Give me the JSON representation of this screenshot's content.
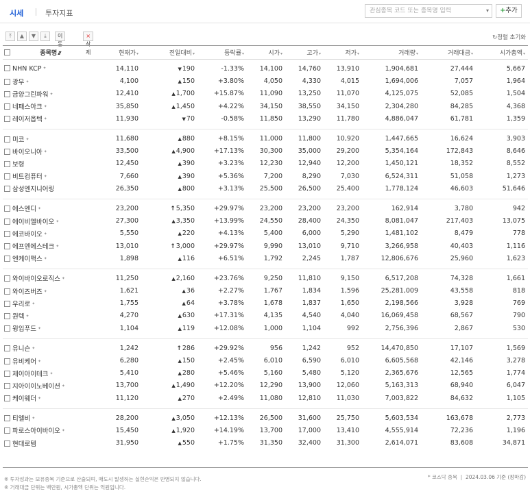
{
  "tabs": [
    {
      "label": "시세",
      "active": true
    },
    {
      "label": "투자지표",
      "active": false
    }
  ],
  "search": {
    "placeholder": "관심종목 코드 또는 종목명 입력",
    "add_label": "추가"
  },
  "tools": {
    "move_label": "이동",
    "delete_label": "삭제",
    "sort_reset_label": "정렬 초기화"
  },
  "columns": [
    "종목명",
    "현재가",
    "전일대비",
    "등락률",
    "시가",
    "고가",
    "저가",
    "거래량",
    "거래대금",
    "시가총액"
  ],
  "groups": [
    [
      {
        "name": "NHN KCP",
        "star": true,
        "price": "14,110",
        "dir": "down",
        "change": "190",
        "rate": "-1.33%",
        "open": "14,100",
        "high": "14,760",
        "low": "13,910",
        "volume": "1,904,681",
        "value": "27,444",
        "cap": "5,667"
      },
      {
        "name": "광무",
        "star": true,
        "price": "4,100",
        "dir": "up",
        "change": "150",
        "rate": "+3.80%",
        "open": "4,050",
        "high": "4,330",
        "low": "4,015",
        "volume": "1,694,006",
        "value": "7,057",
        "cap": "1,964"
      },
      {
        "name": "금양그린파워",
        "star": true,
        "price": "12,410",
        "dir": "up",
        "change": "1,700",
        "rate": "+15.87%",
        "open": "11,090",
        "high": "13,250",
        "low": "11,070",
        "volume": "4,125,075",
        "value": "52,085",
        "cap": "1,504"
      },
      {
        "name": "네패스아크",
        "star": true,
        "price": "35,850",
        "dir": "up",
        "change": "1,450",
        "rate": "+4.22%",
        "open": "34,150",
        "high": "38,550",
        "low": "34,150",
        "volume": "2,304,280",
        "value": "84,285",
        "cap": "4,368"
      },
      {
        "name": "레이저옵텍",
        "star": true,
        "price": "11,930",
        "dir": "down",
        "change": "70",
        "rate": "-0.58%",
        "open": "11,850",
        "high": "13,290",
        "low": "11,780",
        "volume": "4,886,047",
        "value": "61,781",
        "cap": "1,359"
      }
    ],
    [
      {
        "name": "미코",
        "star": true,
        "price": "11,680",
        "dir": "up",
        "change": "880",
        "rate": "+8.15%",
        "open": "11,000",
        "high": "11,800",
        "low": "10,920",
        "volume": "1,447,665",
        "value": "16,624",
        "cap": "3,903"
      },
      {
        "name": "바이오니아",
        "star": true,
        "price": "33,500",
        "dir": "up",
        "change": "4,900",
        "rate": "+17.13%",
        "open": "30,300",
        "high": "35,000",
        "low": "29,200",
        "volume": "5,354,164",
        "value": "172,843",
        "cap": "8,646"
      },
      {
        "name": "보령",
        "star": false,
        "price": "12,450",
        "dir": "up",
        "change": "390",
        "rate": "+3.23%",
        "open": "12,230",
        "high": "12,940",
        "low": "12,200",
        "volume": "1,450,121",
        "value": "18,352",
        "cap": "8,552"
      },
      {
        "name": "비트컴퓨터",
        "star": true,
        "price": "7,660",
        "dir": "up",
        "change": "390",
        "rate": "+5.36%",
        "open": "7,200",
        "high": "8,290",
        "low": "7,030",
        "volume": "6,524,311",
        "value": "51,058",
        "cap": "1,273"
      },
      {
        "name": "삼성엔지니어링",
        "star": false,
        "price": "26,350",
        "dir": "up",
        "change": "800",
        "rate": "+3.13%",
        "open": "25,500",
        "high": "26,500",
        "low": "25,400",
        "volume": "1,778,124",
        "value": "46,603",
        "cap": "51,646"
      }
    ],
    [
      {
        "name": "에스엔디",
        "star": true,
        "price": "23,200",
        "dir": "limit",
        "change": "5,350",
        "rate": "+29.97%",
        "open": "23,200",
        "high": "23,200",
        "low": "23,200",
        "volume": "162,914",
        "value": "3,780",
        "cap": "942"
      },
      {
        "name": "에이비엘바이오",
        "star": true,
        "price": "27,300",
        "dir": "up",
        "change": "3,350",
        "rate": "+13.99%",
        "open": "24,550",
        "high": "28,400",
        "low": "24,350",
        "volume": "8,081,047",
        "value": "217,403",
        "cap": "13,075"
      },
      {
        "name": "에코바이오",
        "star": true,
        "price": "5,550",
        "dir": "up",
        "change": "220",
        "rate": "+4.13%",
        "open": "5,400",
        "high": "6,000",
        "low": "5,290",
        "volume": "1,481,102",
        "value": "8,479",
        "cap": "778"
      },
      {
        "name": "에프엔에스테크",
        "star": true,
        "price": "13,010",
        "dir": "limit",
        "change": "3,000",
        "rate": "+29.97%",
        "open": "9,990",
        "high": "13,010",
        "low": "9,710",
        "volume": "3,266,958",
        "value": "40,403",
        "cap": "1,116"
      },
      {
        "name": "엔케이맥스",
        "star": true,
        "price": "1,898",
        "dir": "up",
        "change": "116",
        "rate": "+6.51%",
        "open": "1,792",
        "high": "2,245",
        "low": "1,787",
        "volume": "12,806,676",
        "value": "25,960",
        "cap": "1,623"
      }
    ],
    [
      {
        "name": "와이바이오로직스",
        "star": true,
        "price": "11,250",
        "dir": "up",
        "change": "2,160",
        "rate": "+23.76%",
        "open": "9,250",
        "high": "11,810",
        "low": "9,150",
        "volume": "6,517,208",
        "value": "74,328",
        "cap": "1,661"
      },
      {
        "name": "와이즈버즈",
        "star": true,
        "price": "1,621",
        "dir": "up",
        "change": "36",
        "rate": "+2.27%",
        "open": "1,767",
        "high": "1,834",
        "low": "1,596",
        "volume": "25,281,009",
        "value": "43,558",
        "cap": "818"
      },
      {
        "name": "우리로",
        "star": true,
        "price": "1,755",
        "dir": "up",
        "change": "64",
        "rate": "+3.78%",
        "open": "1,678",
        "high": "1,837",
        "low": "1,650",
        "volume": "2,198,566",
        "value": "3,928",
        "cap": "769"
      },
      {
        "name": "원텍",
        "star": true,
        "price": "4,270",
        "dir": "up",
        "change": "630",
        "rate": "+17.31%",
        "open": "4,135",
        "high": "4,540",
        "low": "4,040",
        "volume": "16,069,458",
        "value": "68,567",
        "cap": "790"
      },
      {
        "name": "윙입푸드",
        "star": true,
        "price": "1,104",
        "dir": "up",
        "change": "119",
        "rate": "+12.08%",
        "open": "1,000",
        "high": "1,104",
        "low": "992",
        "volume": "2,756,396",
        "value": "2,867",
        "cap": "530"
      }
    ],
    [
      {
        "name": "유니슨",
        "star": true,
        "price": "1,242",
        "dir": "limit",
        "change": "286",
        "rate": "+29.92%",
        "open": "956",
        "high": "1,242",
        "low": "952",
        "volume": "14,470,850",
        "value": "17,107",
        "cap": "1,569"
      },
      {
        "name": "유비케어",
        "star": true,
        "price": "6,280",
        "dir": "up",
        "change": "150",
        "rate": "+2.45%",
        "open": "6,010",
        "high": "6,590",
        "low": "6,010",
        "volume": "6,605,568",
        "value": "42,146",
        "cap": "3,278"
      },
      {
        "name": "제이아이테크",
        "star": true,
        "price": "5,410",
        "dir": "up",
        "change": "280",
        "rate": "+5.46%",
        "open": "5,160",
        "high": "5,480",
        "low": "5,120",
        "volume": "2,365,676",
        "value": "12,565",
        "cap": "1,774"
      },
      {
        "name": "지아이이노베이션",
        "star": true,
        "price": "13,700",
        "dir": "up",
        "change": "1,490",
        "rate": "+12.20%",
        "open": "12,290",
        "high": "13,900",
        "low": "12,060",
        "volume": "5,163,313",
        "value": "68,940",
        "cap": "6,047"
      },
      {
        "name": "케이웨더",
        "star": true,
        "price": "11,120",
        "dir": "up",
        "change": "270",
        "rate": "+2.49%",
        "open": "11,080",
        "high": "12,810",
        "low": "11,030",
        "volume": "7,003,822",
        "value": "84,632",
        "cap": "1,105"
      }
    ],
    [
      {
        "name": "티엘비",
        "star": true,
        "price": "28,200",
        "dir": "up",
        "change": "3,050",
        "rate": "+12.13%",
        "open": "26,500",
        "high": "31,600",
        "low": "25,750",
        "volume": "5,603,534",
        "value": "163,678",
        "cap": "2,773"
      },
      {
        "name": "파로스아이바이오",
        "star": true,
        "price": "15,450",
        "dir": "up",
        "change": "1,920",
        "rate": "+14.19%",
        "open": "13,700",
        "high": "17,000",
        "low": "13,410",
        "volume": "4,555,914",
        "value": "72,236",
        "cap": "1,196"
      },
      {
        "name": "현대로템",
        "star": false,
        "price": "31,950",
        "dir": "up",
        "change": "550",
        "rate": "+1.75%",
        "open": "31,350",
        "high": "32,400",
        "low": "31,300",
        "volume": "2,614,071",
        "value": "83,608",
        "cap": "34,871"
      }
    ]
  ],
  "footer": {
    "note1": "※ 투자성과는 보유종목 기준으로 산출되며, 매도시 발생하는 실현손익은 반영되지 않습니다.",
    "note2": "※ 거래대금 단위는 백만원, 시가총액 단위는 억원입니다.",
    "legend": "* 코스닥 종목",
    "date": "2024.03.06 기준 (장마감)"
  },
  "colors": {
    "up": "#e03131",
    "down": "#1a5bd6",
    "accent": "#1a5bd6"
  }
}
